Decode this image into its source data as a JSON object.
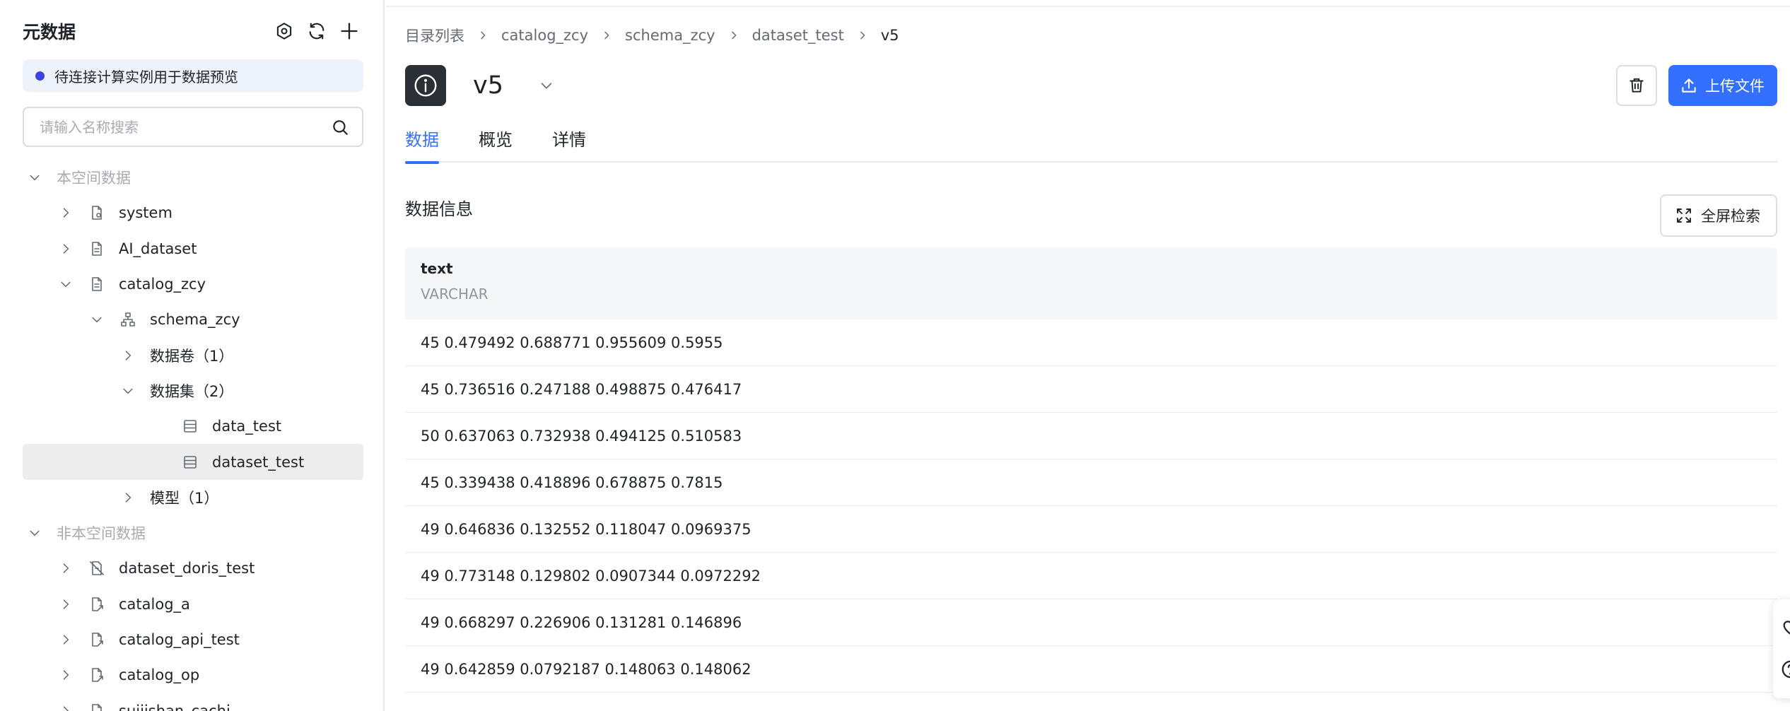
{
  "sidebar": {
    "title": "元数据",
    "notice": "待连接计算实例用于数据预览",
    "search_placeholder": "请输入名称搜索",
    "tree": [
      {
        "label": "本空间数据",
        "depth": 0,
        "chevron": "down",
        "icon": "",
        "group": true
      },
      {
        "label": "system",
        "depth": 1,
        "chevron": "right",
        "icon": "doc-gear"
      },
      {
        "label": "AI_dataset",
        "depth": 1,
        "chevron": "right",
        "icon": "doc"
      },
      {
        "label": "catalog_zcy",
        "depth": 1,
        "chevron": "down",
        "icon": "doc"
      },
      {
        "label": "schema_zcy",
        "depth": 2,
        "chevron": "down",
        "icon": "hierarchy"
      },
      {
        "label": "数据卷（1）",
        "depth": 3,
        "chevron": "right",
        "icon": ""
      },
      {
        "label": "数据集（2）",
        "depth": 3,
        "chevron": "down",
        "icon": ""
      },
      {
        "label": "data_test",
        "depth": 4,
        "chevron": "",
        "icon": "table"
      },
      {
        "label": "dataset_test",
        "depth": 4,
        "chevron": "",
        "icon": "table",
        "selected": true
      },
      {
        "label": "模型（1）",
        "depth": 3,
        "chevron": "right",
        "icon": ""
      },
      {
        "label": "非本空间数据",
        "depth": 0,
        "chevron": "down",
        "icon": "",
        "group": true
      },
      {
        "label": "dataset_doris_test",
        "depth": 1,
        "chevron": "right",
        "icon": "link-off"
      },
      {
        "label": "catalog_a",
        "depth": 1,
        "chevron": "right",
        "icon": "doc-link"
      },
      {
        "label": "catalog_api_test",
        "depth": 1,
        "chevron": "right",
        "icon": "doc-link"
      },
      {
        "label": "catalog_op",
        "depth": 1,
        "chevron": "right",
        "icon": "doc-link"
      },
      {
        "label": "suijishan_cachi",
        "depth": 1,
        "chevron": "right",
        "icon": "doc-link"
      }
    ]
  },
  "main": {
    "breadcrumb": [
      "目录列表",
      "catalog_zcy",
      "schema_zcy",
      "dataset_test",
      "v5"
    ],
    "title": "v5",
    "upload_label": "上传文件",
    "tabs": [
      {
        "label": "数据",
        "active": true
      },
      {
        "label": "概览"
      },
      {
        "label": "详情"
      }
    ],
    "section_title": "数据信息",
    "fullscreen_label": "全屏检索",
    "table": {
      "column_name": "text",
      "column_type": "VARCHAR",
      "rows": [
        "45 0.479492 0.688771 0.955609 0.5955",
        "45 0.736516 0.247188 0.498875 0.476417",
        "50 0.637063 0.732938 0.494125 0.510583",
        "45 0.339438 0.418896 0.678875 0.7815",
        "49 0.646836 0.132552 0.118047 0.0969375",
        "49 0.773148 0.129802 0.0907344 0.0972292",
        "49 0.668297 0.226906 0.131281 0.146896",
        "49 0.642859 0.0792187 0.148063 0.148062"
      ]
    }
  },
  "colors": {
    "accent": "#3370ff",
    "notice_dot": "#3a43e0",
    "selected_row": "#ededee"
  }
}
